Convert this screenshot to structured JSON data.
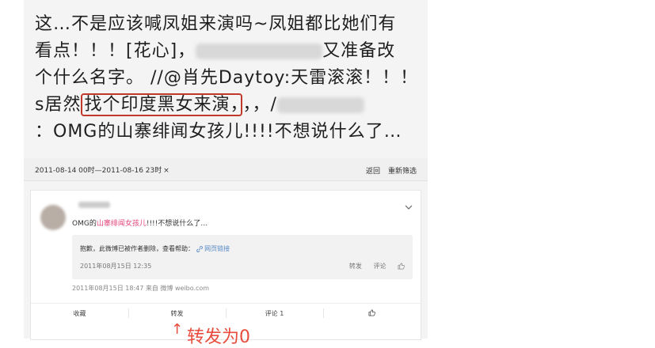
{
  "post": {
    "line1": "这…不是应该喊凤姐来演吗~凤姐都比她们有",
    "line2_a": "看点！！！[花心]，",
    "line2_b": "又准备改",
    "line3": "个什么名字。 //@肖先Daytoy:天雷滚滚！！！",
    "line4_a": "s居然",
    "line4_hl": "找个印度黑女来演，",
    "line4_b": "，，/",
    "line5": "：OMG的山寨绯闻女孩儿!!!!不想说什么了…"
  },
  "filter": {
    "chip": "2011-08-14 00时—2011-08-16 23时",
    "chip_close": "×",
    "back": "返回",
    "reset": "重新筛选"
  },
  "card": {
    "text_prefix": "OMG的",
    "text_pink": "山寨绯闻女孩儿",
    "text_suffix": "!!!!不想说什么了…",
    "quote_msg": "抱歉，此微博已被作者删除，查看帮助：",
    "quote_link": "网页链接",
    "quote_time": "2011年08月15日 12:35",
    "quote_repost": "转发",
    "quote_comment": "评论",
    "meta": "2011年08月15日 18:47  来自 微博 weibo.com",
    "act_collect": "收藏",
    "act_repost": "转发",
    "act_comment": "评论 1"
  },
  "annotation": {
    "note": "转发为0"
  },
  "icons": [
    "chevron-down-icon",
    "link-icon",
    "thumbs-up-icon",
    "arrow-up-icon"
  ],
  "colors": {
    "highlight_border": "#c0392b",
    "pink_text": "#e6477a",
    "link": "#5a8ac8",
    "annotation_red": "#e74c3c"
  }
}
